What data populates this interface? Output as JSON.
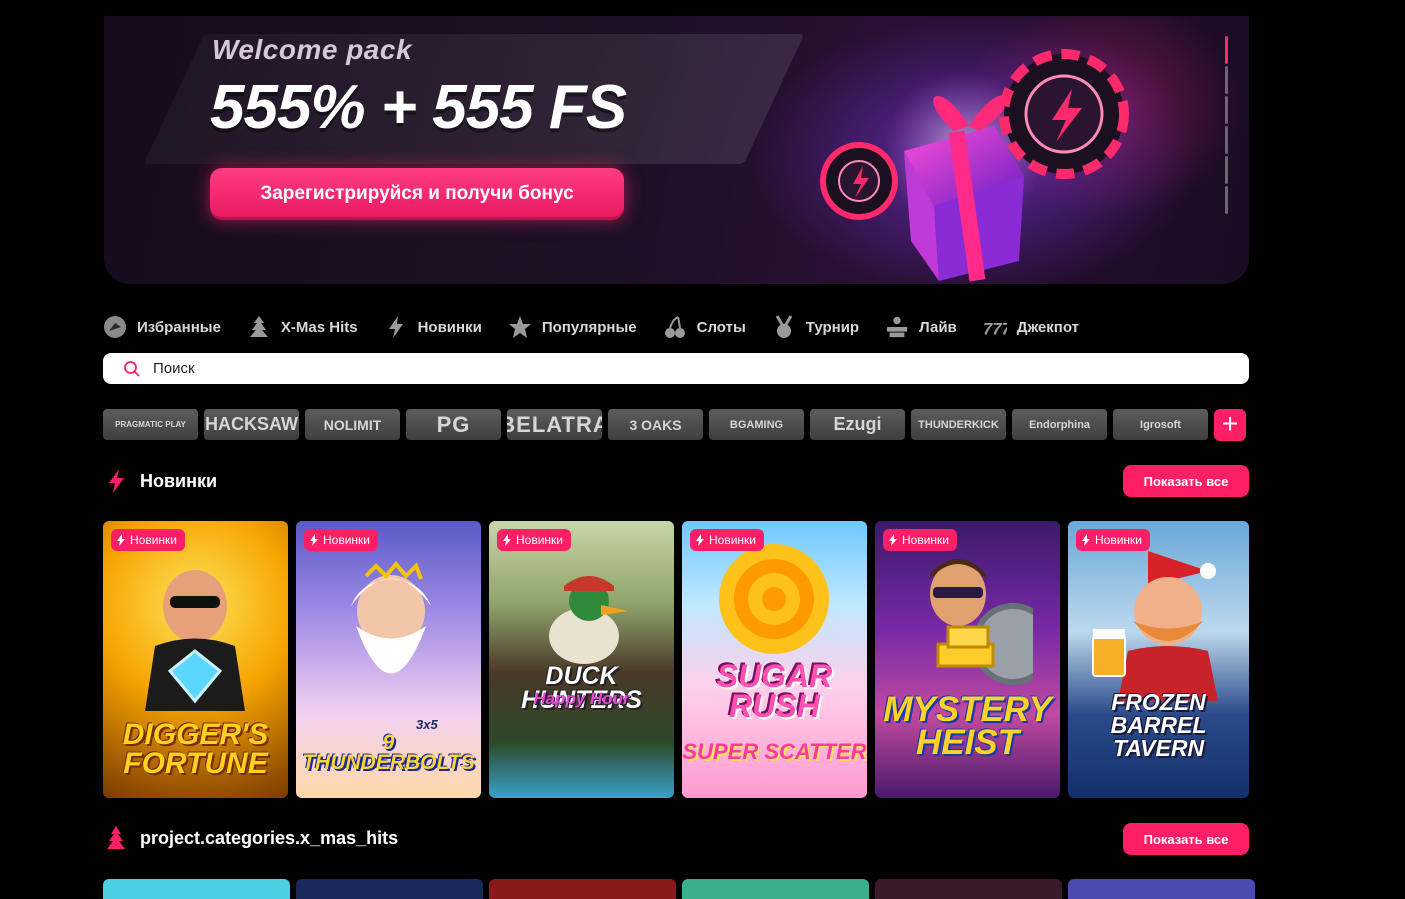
{
  "banner": {
    "welcome": "Welcome pack",
    "headline": "555% + 555 FS",
    "cta_label": "Зарегистрируйся и получи бонус",
    "slides": 6,
    "active_slide": 1
  },
  "categories": [
    {
      "label": "Избранные",
      "icon": "favorites-icon"
    },
    {
      "label": "X-Mas Hits",
      "icon": "christmas-tree-icon"
    },
    {
      "label": "Новинки",
      "icon": "lightning-icon"
    },
    {
      "label": "Популярные",
      "icon": "star-icon"
    },
    {
      "label": "Слоты",
      "icon": "cherries-icon"
    },
    {
      "label": "Турнир",
      "icon": "medal-icon"
    },
    {
      "label": "Лайв",
      "icon": "dealer-icon"
    },
    {
      "label": "Джекпот",
      "icon": "jackpot-777-icon"
    }
  ],
  "search": {
    "placeholder": "Поиск"
  },
  "providers": [
    "PRAGMATIC PLAY",
    "HACKSAW",
    "NOLIMIT",
    "PG",
    "BELATRA",
    "3 OAKS",
    "BGAMING",
    "Ezugi",
    "THUNDERKICK",
    "Endorphina",
    "Igrosoft"
  ],
  "sections": [
    {
      "title": "Новинки",
      "show_all": "Показать все",
      "games": [
        {
          "badge": "Новинки",
          "title": "Digger's Fortune"
        },
        {
          "badge": "Новинки",
          "title": "9 Thunderbolts",
          "subtitle": "3x5"
        },
        {
          "badge": "Новинки",
          "title": "Duck Hunters",
          "subtitle": "Happy Hour"
        },
        {
          "badge": "Новинки",
          "title": "Sugar Rush",
          "subtitle": "Super Scatter"
        },
        {
          "badge": "Новинки",
          "title": "Mystery Heist"
        },
        {
          "badge": "Новинки",
          "title": "Frozen Barrel Tavern"
        }
      ]
    },
    {
      "title": "project.categories.x_mas_hits",
      "show_all": "Показать все"
    }
  ],
  "colors": {
    "accent": "#ff1f66",
    "background": "#000000"
  }
}
